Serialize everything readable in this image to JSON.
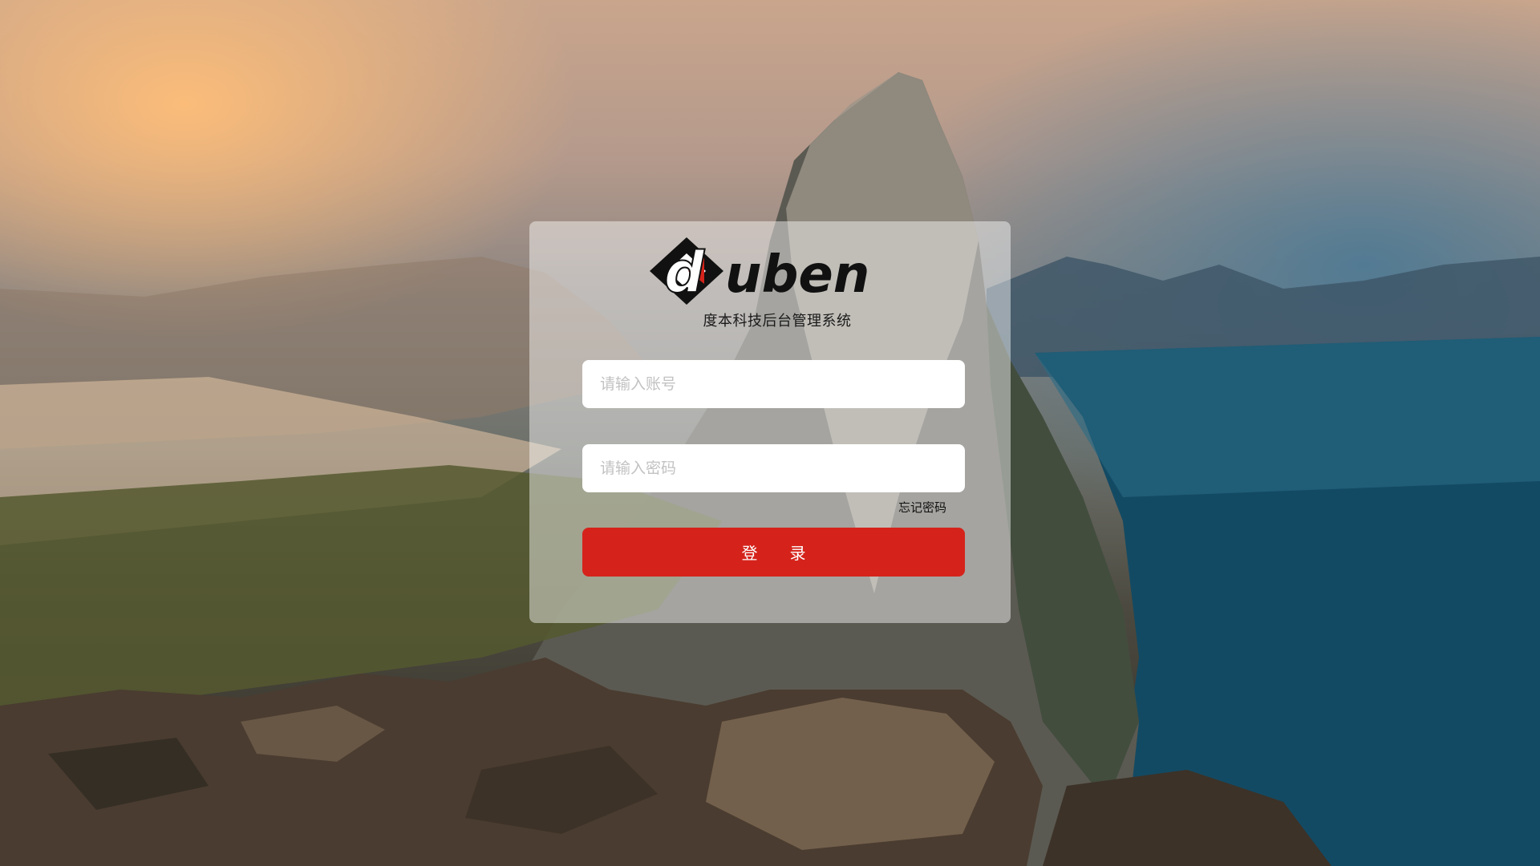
{
  "brand": {
    "logo_text": "uben",
    "logo_mark": "d",
    "subtitle": "度本科技后台管理系统"
  },
  "form": {
    "account_placeholder": "请输入账号",
    "account_value": "",
    "password_placeholder": "请输入密码",
    "password_value": "",
    "forgot_label": "忘记密码",
    "login_label": "登录"
  },
  "colors": {
    "login_button": "#d5231b",
    "card_overlay": "rgba(255,255,255,0.45)"
  },
  "icons": {
    "logo": "duben-logo-icon"
  }
}
